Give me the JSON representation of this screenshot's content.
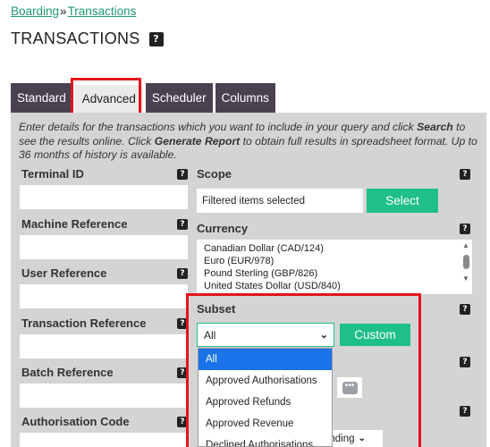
{
  "breadcrumb": {
    "root": "Boarding",
    "separator": "»",
    "current": "Transactions"
  },
  "page": {
    "title": "TRANSACTIONS",
    "help": "?"
  },
  "tabs": [
    {
      "label": "Standard",
      "active": false
    },
    {
      "label": "Advanced",
      "active": true
    },
    {
      "label": "Scheduler",
      "active": false
    },
    {
      "label": "Columns",
      "active": false
    }
  ],
  "intro": {
    "p1": "Enter details for the transactions which you want to include in your query and click ",
    "search": "Search",
    "p2": " to see the results online. Click ",
    "generate": "Generate Report",
    "p3": " to obtain full results in spreadsheet format. Up to 36 months of history is available."
  },
  "fields": {
    "terminal_id": "Terminal ID",
    "machine_reference": "Machine Reference",
    "user_reference": "User Reference",
    "transaction_reference": "Transaction Reference",
    "batch_reference": "Batch Reference",
    "authorisation_code": "Authorisation Code"
  },
  "scope": {
    "label": "Scope",
    "value": "Filtered items selected",
    "button": "Select"
  },
  "currency": {
    "label": "Currency",
    "options": [
      "Canadian Dollar (CAD/124)",
      "Euro (EUR/978)",
      "Pound Sterling (GBP/826)",
      "United States Dollar (USD/840)"
    ]
  },
  "subset": {
    "label": "Subset",
    "selected": "All",
    "button": "Custom",
    "options": [
      "All",
      "Approved Authorisations",
      "Approved Refunds",
      "Approved Revenue",
      "Declined Authorisations"
    ]
  },
  "partial_select_value": "ending",
  "help_glyph": "?",
  "colors": {
    "accent": "#1fbf8a",
    "tab_bg": "#4a4150",
    "highlight": "#e4131b",
    "link": "#1f9a6e"
  }
}
